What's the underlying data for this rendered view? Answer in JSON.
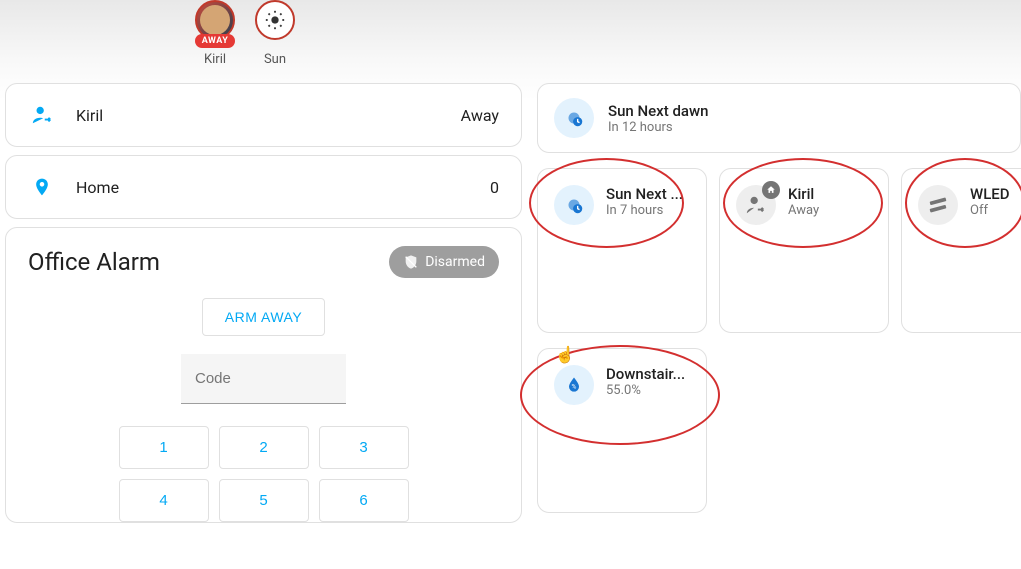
{
  "top_badges": {
    "user": {
      "name": "Kiril",
      "status": "AWAY"
    },
    "sun": {
      "label": "Sun"
    }
  },
  "left": {
    "person_row": {
      "name": "Kiril",
      "state": "Away"
    },
    "home_row": {
      "label": "Home",
      "value": "0"
    },
    "alarm": {
      "title": "Office Alarm",
      "status": "Disarmed",
      "arm_button": "ARM AWAY",
      "code_placeholder": "Code",
      "keys": [
        "1",
        "2",
        "3",
        "4",
        "5",
        "6"
      ]
    }
  },
  "right": {
    "dawn": {
      "title": "Sun Next dawn",
      "sub": "In 12 hours"
    },
    "tiles": [
      {
        "id": "sun-next",
        "title": "Sun Next ...",
        "sub": "In 7 hours",
        "icon": "sun-clock",
        "color": "blue"
      },
      {
        "id": "kiril",
        "title": "Kiril",
        "sub": "Away",
        "icon": "person-arrow",
        "color": "gray",
        "badge": true
      },
      {
        "id": "wled",
        "title": "WLED",
        "sub": "Off",
        "icon": "led",
        "color": "gray"
      }
    ],
    "humidity": {
      "title": "Downstair...",
      "sub": "55.0%"
    }
  }
}
